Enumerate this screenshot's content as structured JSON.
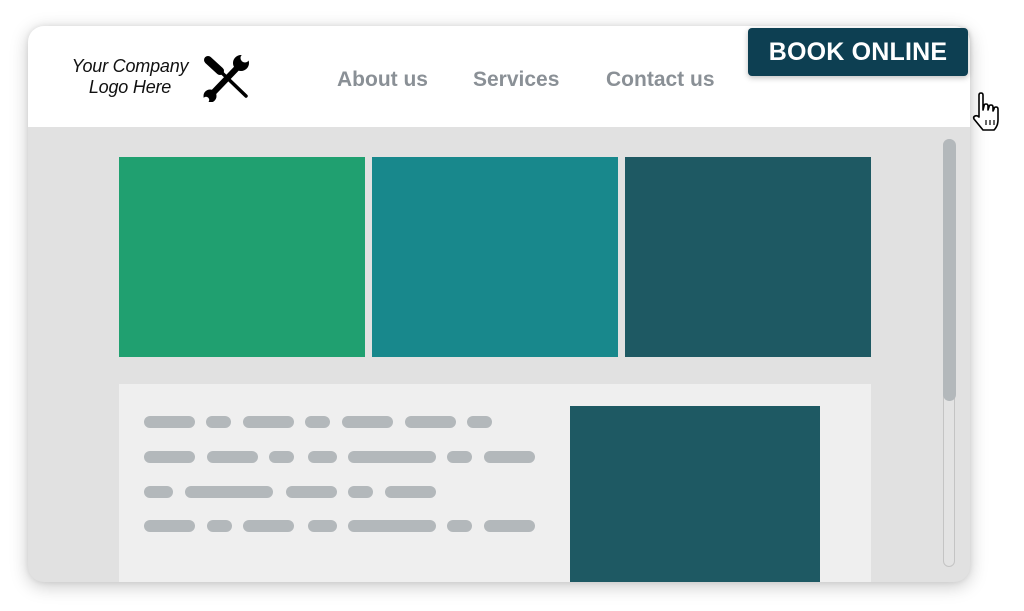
{
  "header": {
    "logo": {
      "line1": "Your Company",
      "line2": "Logo Here",
      "icon": "tools-icon"
    },
    "nav": [
      {
        "label": "About us"
      },
      {
        "label": "Services"
      },
      {
        "label": "Contact us"
      }
    ],
    "cta": {
      "label": "BOOK ONLINE",
      "color": "#0d3f52"
    },
    "cursor": "pointer-hand-icon"
  },
  "hero_tiles": [
    {
      "color": "#20a070"
    },
    {
      "color": "#18888c"
    },
    {
      "color": "#1e5963"
    }
  ],
  "content_section": {
    "text_placeholder_lines": 4,
    "media_color": "#1e5963",
    "placeholder_color": "#b3b8bb"
  },
  "scrollbar": {
    "position_fraction": 0.0,
    "visible_fraction": 0.61
  }
}
